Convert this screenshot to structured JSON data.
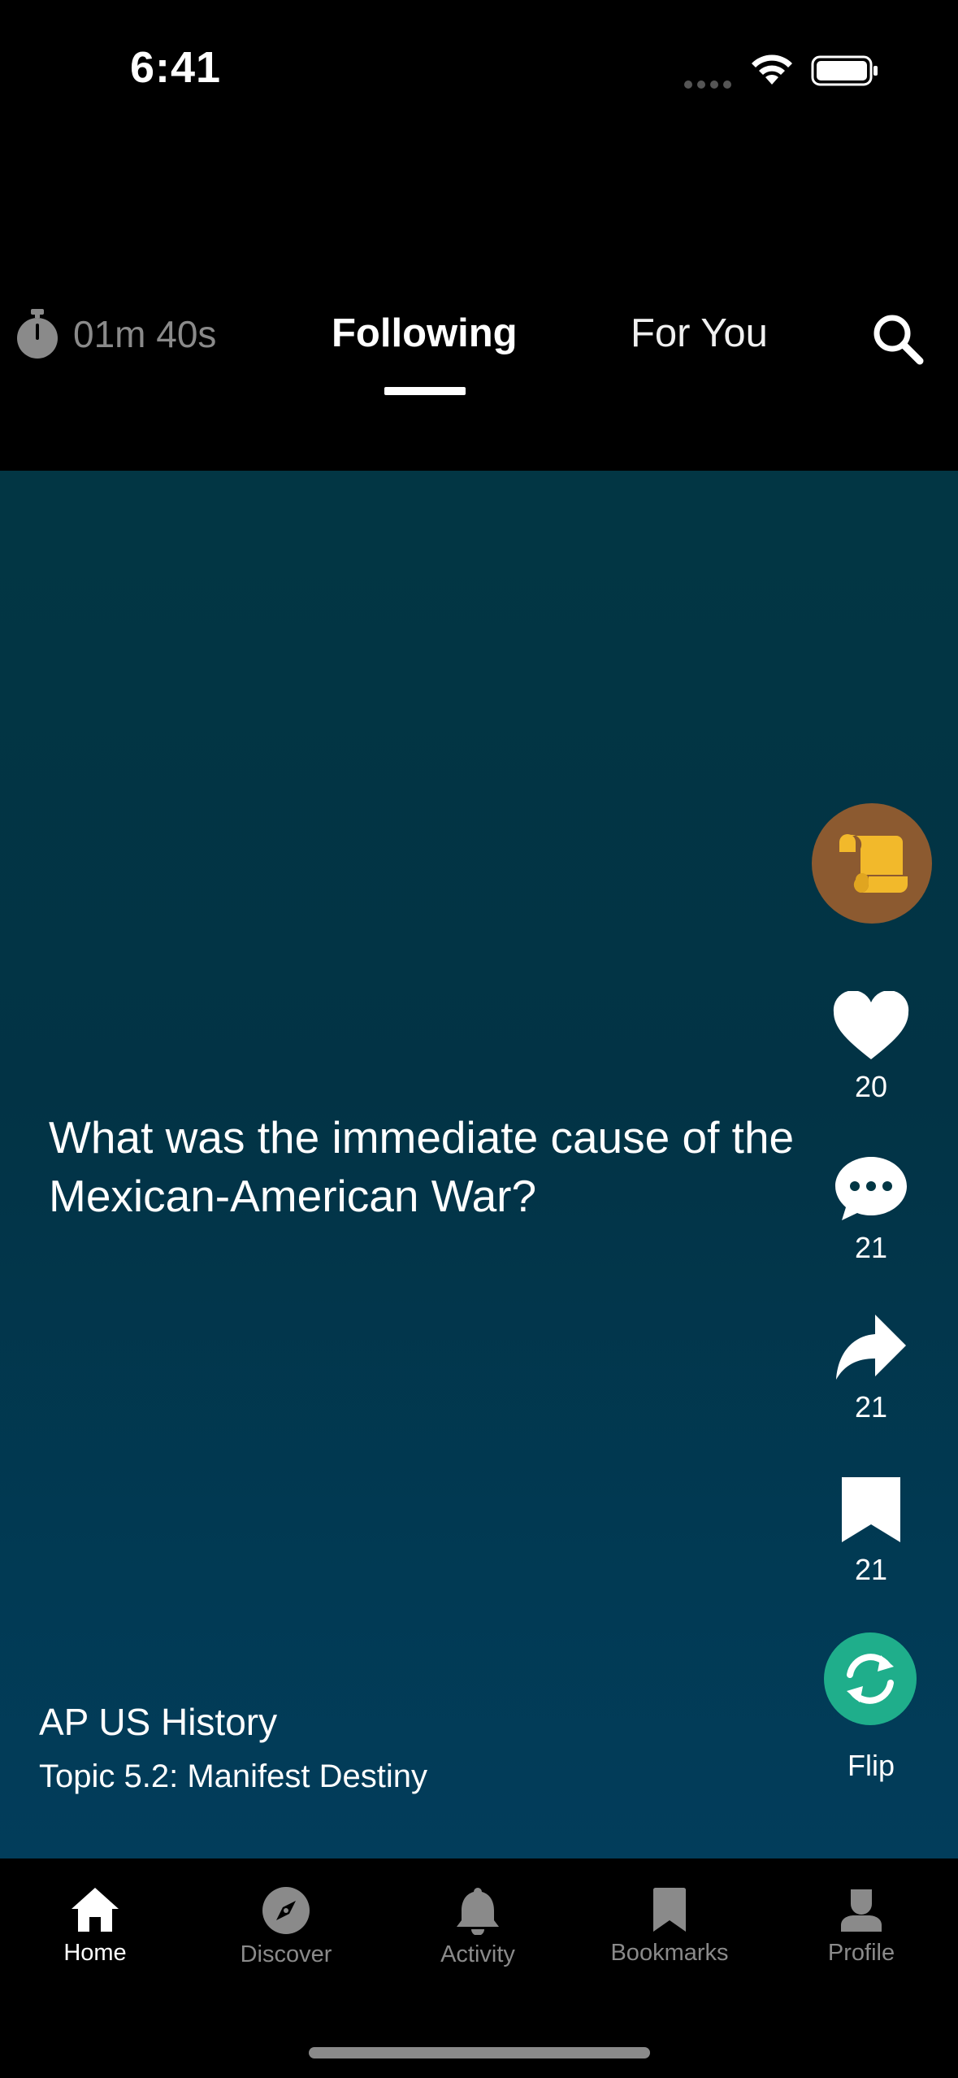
{
  "status_bar": {
    "time": "6:41"
  },
  "top_nav": {
    "timer": "01m 40s",
    "tabs": [
      {
        "label": "Following",
        "active": true
      },
      {
        "label": "For You",
        "active": false
      }
    ]
  },
  "card": {
    "question": "What was the immediate cause of the Mexican-American War?",
    "course": "AP US History",
    "topic": "Topic 5.2: Manifest Destiny"
  },
  "actions": {
    "like_count": "20",
    "comment_count": "21",
    "share_count": "21",
    "bookmark_count": "21",
    "flip_label": "Flip"
  },
  "tab_bar": {
    "items": [
      {
        "label": "Home",
        "icon": "home-icon",
        "active": true
      },
      {
        "label": "Discover",
        "icon": "compass-icon",
        "active": false
      },
      {
        "label": "Activity",
        "icon": "bell-icon",
        "active": false
      },
      {
        "label": "Bookmarks",
        "icon": "bookmark-icon",
        "active": false
      },
      {
        "label": "Profile",
        "icon": "person-icon",
        "active": false
      }
    ]
  },
  "colors": {
    "background": "#000000",
    "card_bg": "#023644",
    "flip_green": "#1fae8b",
    "avatar_brown": "#8c5a30",
    "scroll_yellow": "#f2b92b",
    "inactive": "#8a8a8a"
  }
}
